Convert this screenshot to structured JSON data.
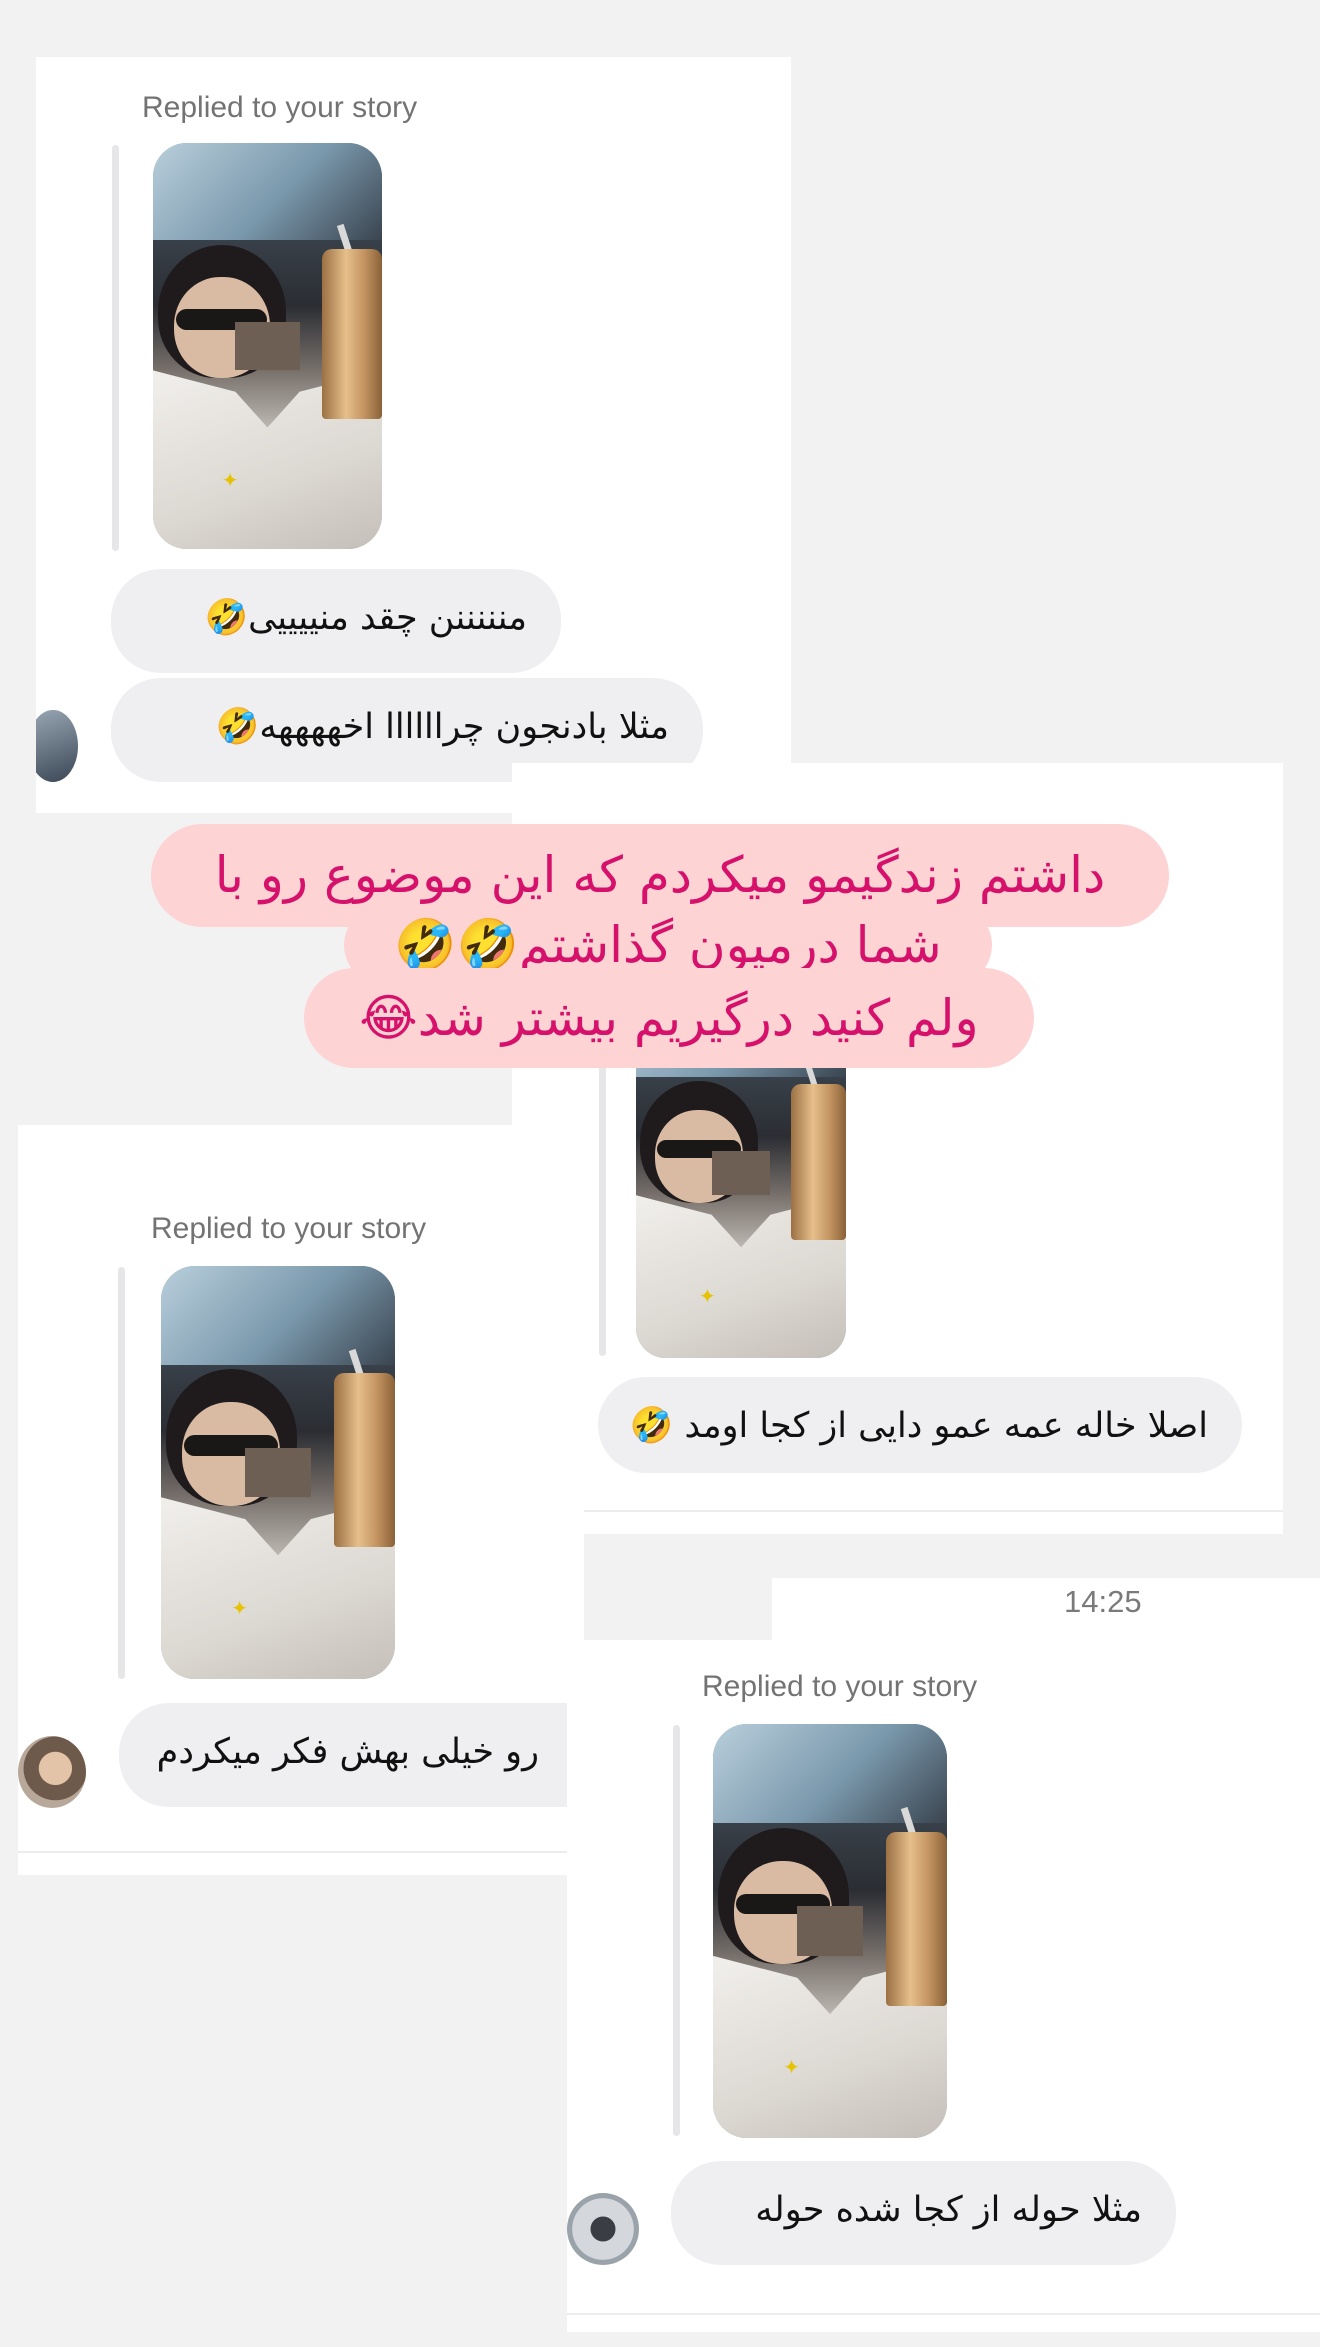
{
  "reply_label": "Replied to your story",
  "messages": [
    {
      "text": "منننننن چقد منییییی🤣"
    },
    {
      "text": "مثلا بادنجون  چراااااا اخههههه🤣"
    },
    {
      "text": "اصلا خاله عمه عمو دایی از کجا اومد 🤣"
    },
    {
      "text": "رو خیلی بهش فکر میکردم"
    },
    {
      "text": "مثلا حوله از کجا شده حوله"
    }
  ],
  "timestamp": "14:25",
  "caption": {
    "line1": "داشتم زندگیمو میکردم که این موضوع رو با",
    "line2": "شما درمیون گذاشتم🤣🤣",
    "line3": "ولم کنید درگیریم بیشتر شد😂"
  },
  "colors": {
    "caption_bg": "#fdd3d4",
    "caption_text": "#d6116b",
    "bubble_bg": "#efeff1",
    "page_bg": "#f2f2f3"
  }
}
